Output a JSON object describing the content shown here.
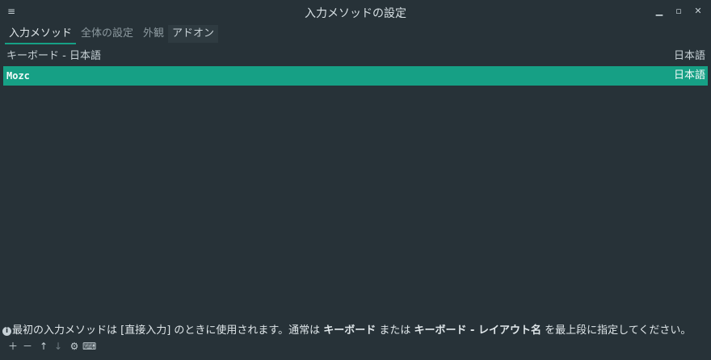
{
  "window": {
    "title": "入力メソッドの設定",
    "menu_icon": "hamburger-icon",
    "minimize_icon": "minimize-icon",
    "maximize_icon": "maximize-icon",
    "close_icon": "close-icon"
  },
  "tabs": [
    {
      "label": "入力メソッド",
      "state": "active"
    },
    {
      "label": "全体の設定",
      "state": "inactive"
    },
    {
      "label": "外観",
      "state": "inactive"
    },
    {
      "label": "アドオン",
      "state": "inactive"
    }
  ],
  "input_methods": [
    {
      "name": "キーボード - 日本語",
      "language": "日本語",
      "selected": false
    },
    {
      "name": "Mozc",
      "language": "日本語",
      "selected": true
    }
  ],
  "hint": {
    "icon": "info-icon",
    "part1": "最初の入力メソッドは [直接入力] のときに使用されます。通常は ",
    "bold1": "キーボード",
    "part2": " または ",
    "bold2": "キーボード - レイアウト名",
    "part3": " を最上段に指定してください。"
  },
  "toolbar": {
    "add_icon": "plus-icon",
    "remove_icon": "minus-icon",
    "up_icon": "arrow-up-icon",
    "down_icon": "arrow-down-icon",
    "configure_icon": "gear-icon",
    "keyboard_icon": "keyboard-icon"
  },
  "colors": {
    "background": "#273238",
    "accent": "#16a085"
  }
}
